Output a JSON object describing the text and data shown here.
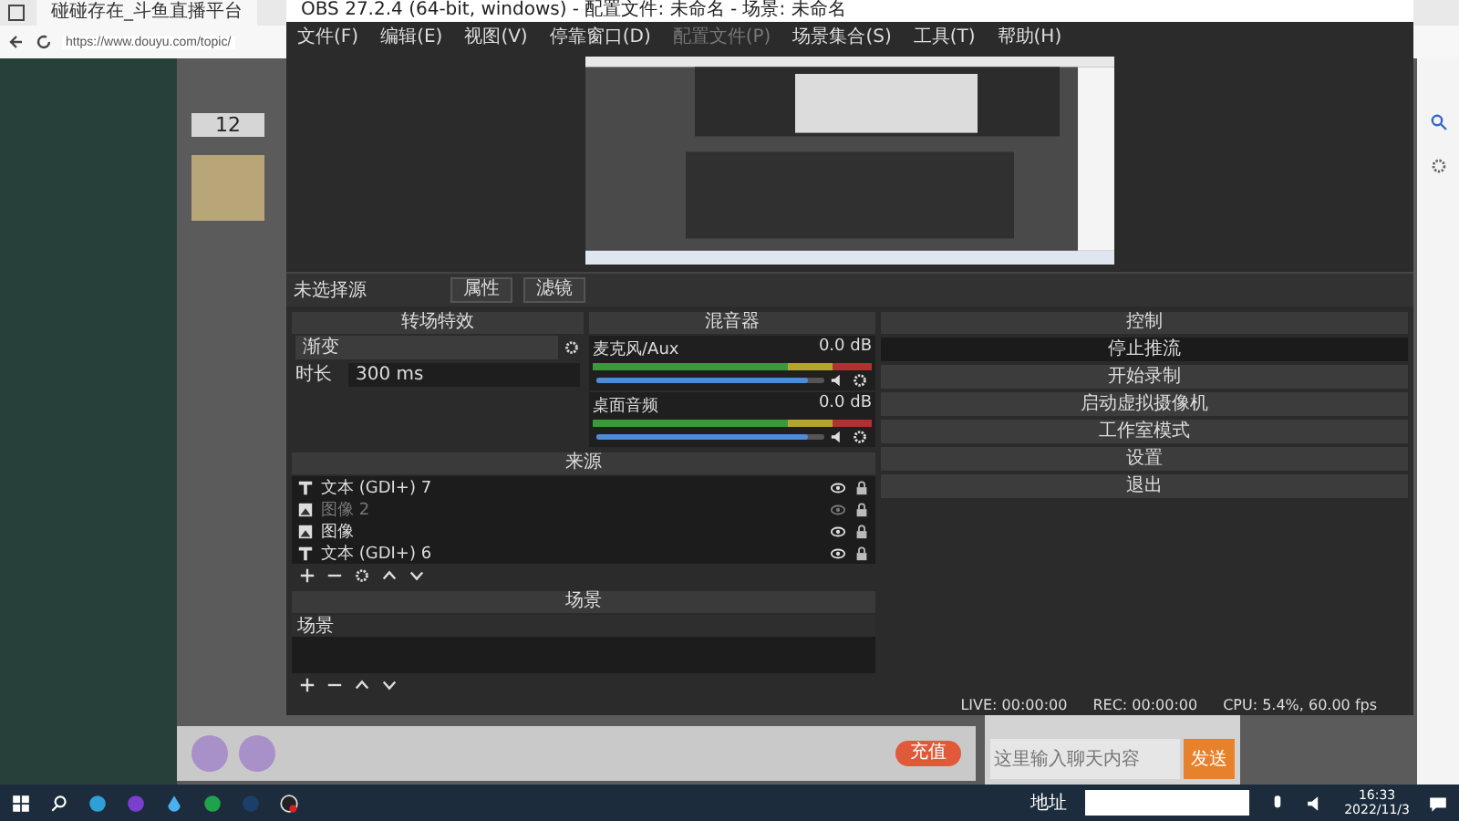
{
  "browser": {
    "tab_title": "碰碰存在_斗鱼直播平台",
    "url": "https://www.douyu.com/topic/",
    "page_count": "12"
  },
  "obs": {
    "title": "OBS 27.2.4 (64-bit, windows) - 配置文件: 未命名 - 场景: 未命名",
    "menu": [
      {
        "label": "文件(F)",
        "disabled": false
      },
      {
        "label": "编辑(E)",
        "disabled": false
      },
      {
        "label": "视图(V)",
        "disabled": false
      },
      {
        "label": "停靠窗口(D)",
        "disabled": false
      },
      {
        "label": "配置文件(P)",
        "disabled": true
      },
      {
        "label": "场景集合(S)",
        "disabled": false
      },
      {
        "label": "工具(T)",
        "disabled": false
      },
      {
        "label": "帮助(H)",
        "disabled": false
      }
    ],
    "toolbar": {
      "source_label": "未选择源",
      "buttons": [
        "属性",
        "滤镜"
      ]
    },
    "transitions": {
      "title": "转场特效",
      "transition": "渐变",
      "duration_label": "时长",
      "duration": "300 ms"
    },
    "mixer": {
      "title": "混音器",
      "channels": [
        {
          "name": "麦克风/Aux",
          "reading": "0.0 dB",
          "level": 0.93
        },
        {
          "name": "桌面音频",
          "reading": "0.0 dB",
          "level": 0.93
        }
      ]
    },
    "sources": {
      "title": "来源",
      "items": [
        {
          "kind": "text",
          "name": "文本 (GDI+) 7",
          "visible": true
        },
        {
          "kind": "image",
          "name": "图像 2",
          "visible": false
        },
        {
          "kind": "image",
          "name": "图像",
          "visible": true
        },
        {
          "kind": "text",
          "name": "文本 (GDI+) 6",
          "visible": true
        }
      ]
    },
    "scenes": {
      "title": "场景",
      "items": [
        {
          "name": "场景",
          "selected": false
        }
      ]
    },
    "controls": {
      "title": "控制",
      "buttons": [
        {
          "label": "停止推流",
          "active": true
        },
        {
          "label": "开始录制",
          "active": false
        },
        {
          "label": "启动虚拟摄像机",
          "active": false
        },
        {
          "label": "工作室模式",
          "active": false
        },
        {
          "label": "设置",
          "active": false
        },
        {
          "label": "退出",
          "active": false
        }
      ]
    },
    "status": {
      "live": "LIVE: 00:00:00",
      "rec": "REC: 00:00:00",
      "cpu": "CPU: 5.4%, 60.00 fps"
    }
  },
  "room": {
    "recharge": "充值",
    "chat_placeholder": "这里输入聊天内容",
    "send": "发送"
  },
  "taskbar": {
    "address_label": "地址",
    "time": "16:33",
    "date": "2022/11/3"
  }
}
